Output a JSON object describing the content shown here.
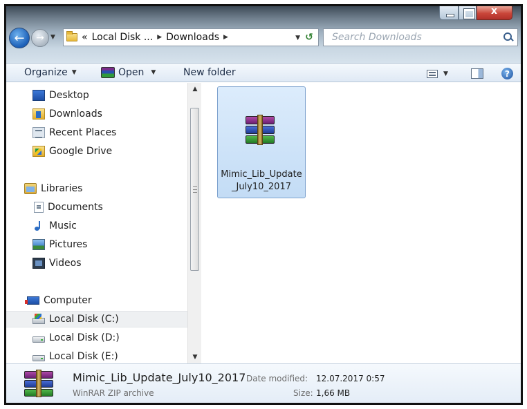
{
  "address": {
    "prefix": "«",
    "crumbs": [
      "Local Disk ...",
      "Downloads"
    ],
    "refresh_icon": "refresh-icon"
  },
  "search": {
    "placeholder": "Search Downloads"
  },
  "toolbar": {
    "organize_label": "Organize",
    "open_label": "Open",
    "new_folder_label": "New folder",
    "help_symbol": "?"
  },
  "nav": {
    "items": [
      {
        "label": "Desktop",
        "icon": "desktop-icon"
      },
      {
        "label": "Downloads",
        "icon": "downloads-folder-icon"
      },
      {
        "label": "Recent Places",
        "icon": "recent-places-icon"
      },
      {
        "label": "Google Drive",
        "icon": "google-drive-icon"
      },
      {
        "label": "Libraries",
        "icon": "libraries-icon"
      },
      {
        "label": "Documents",
        "icon": "documents-icon"
      },
      {
        "label": "Music",
        "icon": "music-icon"
      },
      {
        "label": "Pictures",
        "icon": "pictures-icon"
      },
      {
        "label": "Videos",
        "icon": "videos-icon"
      },
      {
        "label": "Computer",
        "icon": "computer-icon"
      },
      {
        "label": "Local Disk (C:)",
        "icon": "local-disk-c-icon",
        "selected": true
      },
      {
        "label": "Local Disk (D:)",
        "icon": "drive-icon"
      },
      {
        "label": "Local Disk (E:)",
        "icon": "drive-icon"
      }
    ]
  },
  "files": [
    {
      "name": "Mimic_Lib_Update_July10_2017",
      "icon": "winrar-archive-icon",
      "selected": true
    }
  ],
  "details": {
    "name": "Mimic_Lib_Update_July10_2017",
    "type": "WinRAR ZIP archive",
    "modified_label": "Date modified:",
    "modified_value": "12.07.2017 0:57",
    "size_label": "Size:",
    "size_value": "1,66 MB"
  },
  "colors": {
    "selection_fill": "#c3dcf5",
    "selection_border": "#7da2ce",
    "toolbar_text": "#1e2e48",
    "close_button": "#c9463a"
  }
}
